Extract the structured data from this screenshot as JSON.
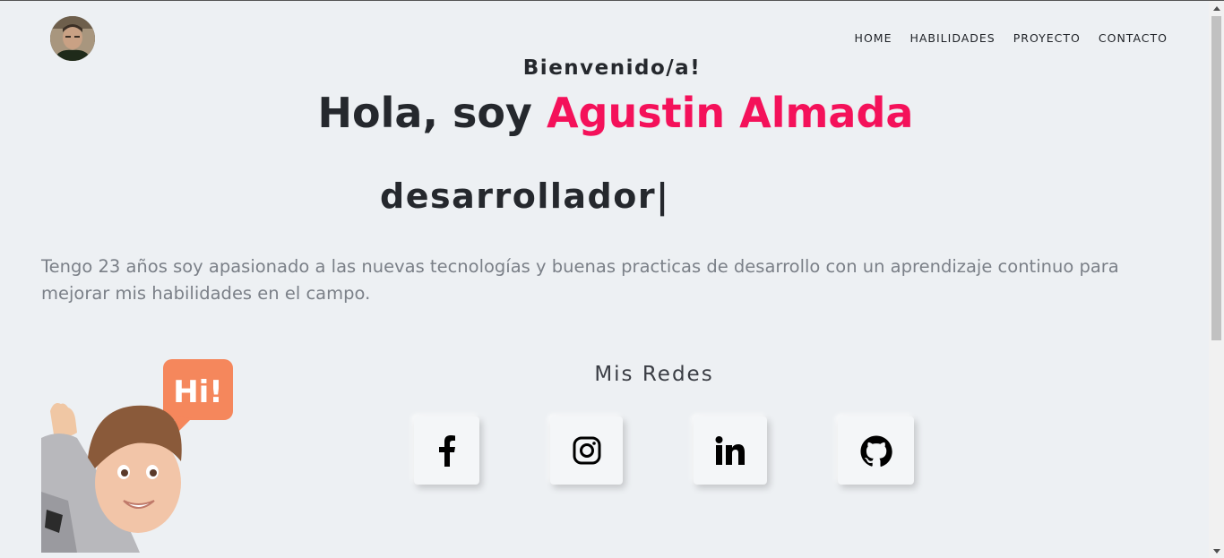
{
  "header": {
    "nav": [
      {
        "label": "HOME"
      },
      {
        "label": "HABILIDADES"
      },
      {
        "label": "PROYECTO"
      },
      {
        "label": "CONTACTO"
      }
    ]
  },
  "hero": {
    "welcome": "Bienvenido/a!",
    "greeting": "Hola, soy ",
    "name": "Agustin Almada",
    "typed_text": "desarrollador|",
    "about": "Tengo 23 años soy apasionado a las nuevas tecnologías y buenas practicas de desarrollo con un aprendizaje continuo para mejorar mis habilidades en el campo."
  },
  "memoji": {
    "speech_bubble": "Hi!"
  },
  "socials": {
    "title": "Mis Redes",
    "items": [
      {
        "icon": "facebook-icon"
      },
      {
        "icon": "instagram-icon"
      },
      {
        "icon": "linkedin-icon"
      },
      {
        "icon": "github-icon"
      }
    ]
  },
  "colors": {
    "accent": "#f4115a",
    "background": "#edf0f3",
    "text": "#25282d",
    "muted_text": "#7b8088"
  }
}
